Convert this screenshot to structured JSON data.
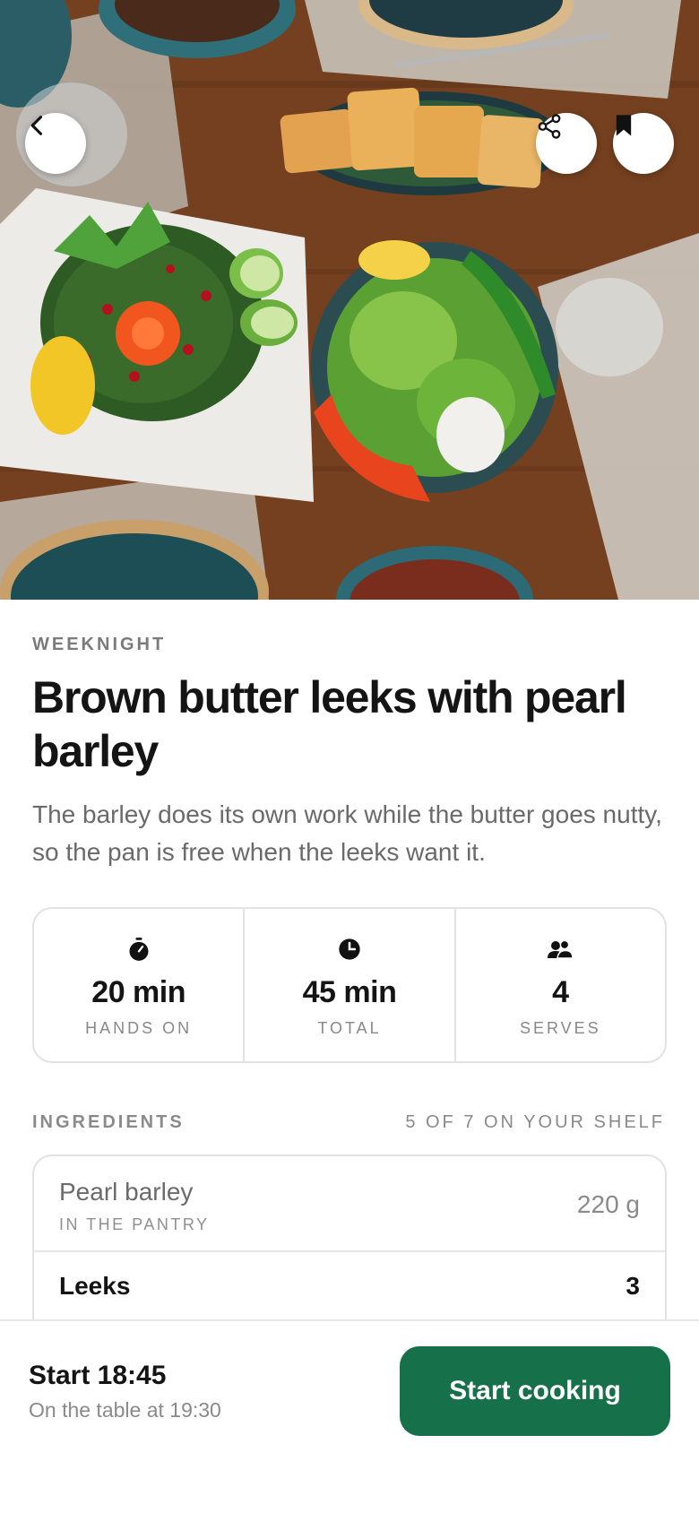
{
  "hero": {
    "image": "tabbouleh-and-vegetables-photo",
    "back_icon": "chevron-left-icon",
    "share_icon": "share-icon",
    "save_icon": "bookmark-icon"
  },
  "recipe": {
    "category": "WEEKNIGHT",
    "title": "Brown butter leeks with pearl barley",
    "description": "The barley does its own work while the butter goes nutty, so the pan is free when the leeks want it."
  },
  "stats": [
    {
      "icon": "stopwatch-icon",
      "value": "20 min",
      "label": "HANDS ON"
    },
    {
      "icon": "clock-icon",
      "value": "45 min",
      "label": "TOTAL"
    },
    {
      "icon": "people-icon",
      "value": "4",
      "label": "SERVES"
    }
  ],
  "ingredients": {
    "heading": "INGREDIENTS",
    "shelf_count": "5 OF 7 ON YOUR SHELF",
    "items": [
      {
        "name": "Pearl barley",
        "note": "IN THE PANTRY",
        "qty": "220 g"
      },
      {
        "name": "Leeks",
        "note": "",
        "qty": "3"
      }
    ]
  },
  "footer": {
    "start_label": "Start 18:45",
    "table_label": "On the table at 19:30",
    "cta_label": "Start cooking"
  },
  "colors": {
    "accent": "#16714a",
    "muted_text": "#8a8a8a",
    "border": "#e2e2e2"
  }
}
